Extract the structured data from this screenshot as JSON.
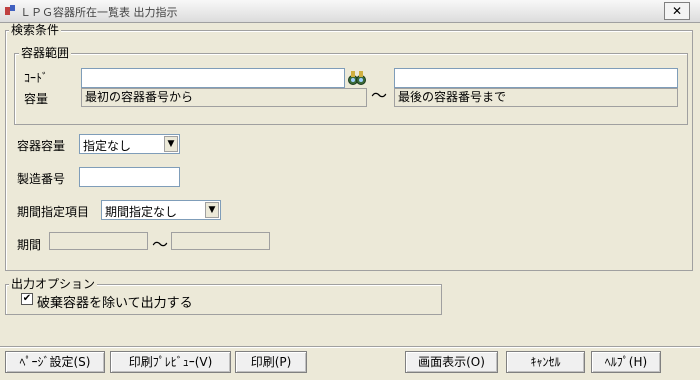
{
  "window": {
    "title": "ＬＰＧ容器所在一覧表 出力指示",
    "close_glyph": "✕"
  },
  "search": {
    "legend": "検索条件",
    "range_group": {
      "legend": "容器範囲",
      "code_label": "ｺｰﾄﾞ",
      "capacity_label": "容量",
      "code_from_value": "",
      "code_to_value": "",
      "from_hint": "最初の容器番号から",
      "to_hint": "最後の容器番号まで",
      "tilde": "～",
      "lookup_icon": "binoculars-icon"
    },
    "capacity": {
      "label": "容器容量",
      "selected": "指定なし"
    },
    "serial": {
      "label": "製造番号",
      "value": ""
    },
    "period_item": {
      "label": "期間指定項目",
      "selected": "期間指定なし"
    },
    "period": {
      "label": "期間",
      "from": "",
      "to": "",
      "tilde": "～"
    }
  },
  "output_options": {
    "legend": "出力オプション",
    "exclude_discarded": {
      "label": "破棄容器を除いて出力する",
      "checked": true
    }
  },
  "buttons": {
    "page_setup": "ﾍﾟｰｼﾞ設定(S)",
    "print_preview": "印刷ﾌﾟﾚﾋﾞｭｰ(V)",
    "print": "印刷(P)",
    "screen_display": "画面表示(O)",
    "cancel": "ｷｬﾝｾﾙ",
    "help": "ﾍﾙﾌﾟ(H)"
  },
  "colors": {
    "face": "#ece9d8",
    "border": "#a0a0a0",
    "input_border": "#7f9db9"
  }
}
